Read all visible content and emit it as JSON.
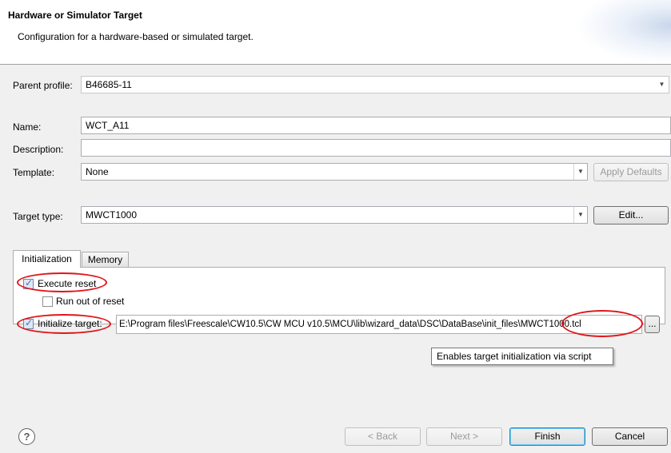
{
  "header": {
    "title": "Hardware or Simulator Target",
    "subtitle": "Configuration for a hardware-based or simulated target."
  },
  "form": {
    "parent_profile_label": "Parent profile:",
    "parent_profile_value": "B46685-11",
    "name_label": "Name:",
    "name_value": "WCT_A11",
    "description_label": "Description:",
    "description_value": "",
    "template_label": "Template:",
    "template_value": "None",
    "apply_defaults_label": "Apply Defaults",
    "target_type_label": "Target type:",
    "target_type_value": "MWCT1000",
    "edit_label": "Edit..."
  },
  "tabs": [
    {
      "label": "Initialization",
      "active": true
    },
    {
      "label": "Memory",
      "active": false
    }
  ],
  "initialization": {
    "execute_reset_label": "Execute reset",
    "execute_reset_checked": true,
    "run_out_of_reset_label": "Run out of reset",
    "run_out_of_reset_checked": false,
    "initialize_target_label": "Initialize target:",
    "initialize_target_checked": true,
    "script_path": "E:\\Program files\\Freescale\\CW10.5\\CW MCU v10.5\\MCU\\lib\\wizard_data\\DSC\\DataBase\\init_files\\MWCT1000.tcl",
    "browse_label": "..."
  },
  "tooltip": "Enables target initialization via script",
  "footer": {
    "help_glyph": "?",
    "back_label": "< Back",
    "next_label": "Next >",
    "finish_label": "Finish",
    "cancel_label": "Cancel"
  },
  "colors": {
    "annotation": "#e0151b",
    "accent": "#3c7fb1"
  }
}
